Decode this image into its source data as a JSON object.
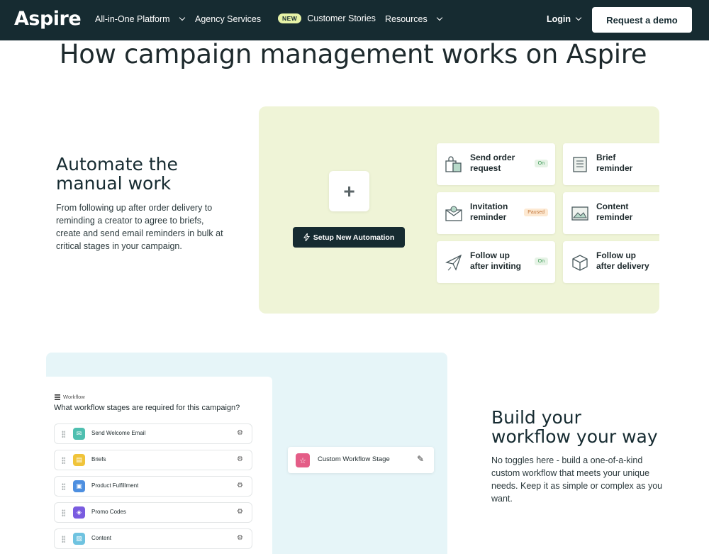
{
  "nav": {
    "logo": "Aspire",
    "items": [
      {
        "label": "All-in-One Platform",
        "has_dropdown": true
      },
      {
        "label": "Agency Services",
        "has_dropdown": false
      },
      {
        "label": "Customer Stories",
        "badge": "NEW",
        "has_dropdown": false
      },
      {
        "label": "Resources",
        "has_dropdown": true
      }
    ],
    "login": "Login",
    "cta": "Request a demo"
  },
  "heading": "How campaign management works on Aspire",
  "section1": {
    "title_line1": "Automate the",
    "title_line2": "manual work",
    "body": "From following up after order delivery to reminding a creator to agree to briefs, create and send email reminders in bulk at critical stages in your campaign.",
    "setup_button": "Setup New Automation",
    "plus_symbol": "+",
    "cards": [
      {
        "line1": "Send order",
        "line2": "request",
        "status": "On",
        "icon": "shopping-bag-icon"
      },
      {
        "line1": "Brief",
        "line2": "reminder",
        "status": "",
        "icon": "document-icon"
      },
      {
        "line1": "Invitation",
        "line2": "reminder",
        "status": "Paused",
        "icon": "envelope-icon"
      },
      {
        "line1": "Content",
        "line2": "reminder",
        "status": "",
        "icon": "image-icon"
      },
      {
        "line1": "Follow up",
        "line2": "after inviting",
        "status": "On",
        "icon": "paper-plane-icon"
      },
      {
        "line1": "Follow up",
        "line2": "after delivery",
        "status": "",
        "icon": "box-icon"
      }
    ]
  },
  "section2": {
    "workflow_tag": "Workflow",
    "question": "What workflow stages are required for this campaign?",
    "stages": [
      {
        "label": "Send Welcome Email",
        "color": "#4fbfb0",
        "icon": "mail-icon"
      },
      {
        "label": "Briefs",
        "color": "#f0c43a",
        "icon": "file-icon"
      },
      {
        "label": "Product Fulfillment",
        "color": "#4d8fe0",
        "icon": "package-icon"
      },
      {
        "label": "Promo Codes",
        "color": "#7a5ce0",
        "icon": "tag-icon"
      },
      {
        "label": "Content",
        "color": "#6fc3e0",
        "icon": "photo-icon"
      }
    ],
    "custom_stage": "Custom Workflow Stage",
    "title_line1": "Build your",
    "title_line2": "workflow your way",
    "body": "No toggles here - build a one-of-a-kind custom workflow that meets your unique needs. Keep it as simple or complex as you want."
  },
  "colors": {
    "nav_bg": "#162b31",
    "green_panel": "#eff4d7",
    "blue_panel": "#e6f5f8",
    "new_badge": "#e6f2a6"
  }
}
